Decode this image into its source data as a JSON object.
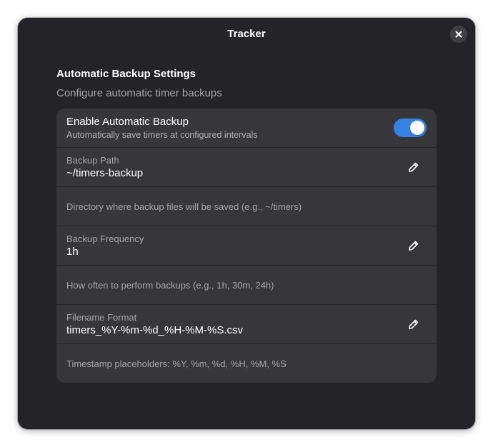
{
  "window": {
    "title": "Tracker"
  },
  "group": {
    "title": "Automatic Backup Settings",
    "description": "Configure automatic timer backups"
  },
  "rows": {
    "enable": {
      "title": "Enable Automatic Backup",
      "subtitle": "Automatically save timers at configured intervals",
      "toggle_on": true
    },
    "path": {
      "caption": "Backup Path",
      "value": "~/timers-backup",
      "help": "Directory where backup files will be saved (e.g., ~/timers)"
    },
    "frequency": {
      "caption": "Backup Frequency",
      "value": "1h",
      "help": "How often to perform backups (e.g., 1h, 30m, 24h)"
    },
    "filename": {
      "caption": "Filename Format",
      "value": "timers_%Y-%m-%d_%H-%M-%S.csv",
      "help": "Timestamp placeholders: %Y, %m, %d, %H, %M, %S"
    }
  },
  "icons": {
    "close": "close-icon",
    "edit": "pencil-icon"
  },
  "colors": {
    "accent": "#3584e4",
    "window_bg": "#242428",
    "card_bg": "#37373b"
  }
}
